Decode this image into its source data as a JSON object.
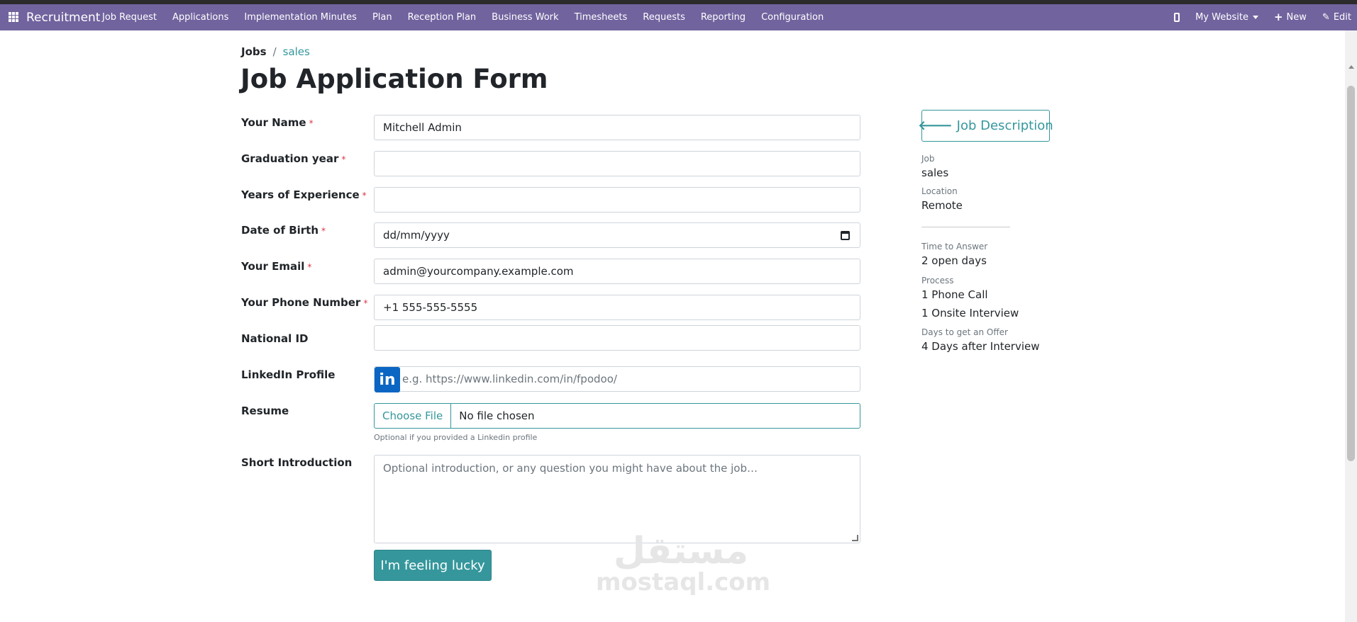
{
  "navbar": {
    "brand": "Recruitment",
    "items": [
      "Job Request",
      "Applications",
      "Implementation Minutes",
      "Plan",
      "Reception Plan",
      "Business Work",
      "Timesheets",
      "Requests",
      "Reporting",
      "Configuration"
    ],
    "website": "My Website",
    "new_label": "New",
    "edit_label": "Edit",
    "color": "#71639e"
  },
  "breadcrumb": {
    "root": "Jobs",
    "separator": "/",
    "current": "sales"
  },
  "page_title": "Job Application Form",
  "form": {
    "required_mark": "*",
    "name": {
      "label": "Your Name",
      "value": "Mitchell Admin"
    },
    "graduation": {
      "label": "Graduation year",
      "value": ""
    },
    "experience": {
      "label": "Years of Experience",
      "value": ""
    },
    "dob": {
      "label": "Date of Birth",
      "placeholder": "dd/mm/yyyy"
    },
    "email": {
      "label": "Your Email",
      "value": "admin@yourcompany.example.com"
    },
    "phone": {
      "label": "Your Phone Number",
      "value": "+1 555-555-5555"
    },
    "national_id": {
      "label": "National ID",
      "value": ""
    },
    "linkedin": {
      "label": "LinkedIn Profile",
      "logo_text": "in",
      "placeholder": "e.g. https://www.linkedin.com/in/fpodoo/"
    },
    "resume": {
      "label": "Resume",
      "choose_label": "Choose File",
      "file_status": "No file chosen",
      "help": "Optional if you provided a Linkedin profile"
    },
    "intro": {
      "label": "Short Introduction",
      "placeholder": "Optional introduction, or any question you might have about the job…"
    },
    "submit_label": "I'm feeling lucky",
    "accent_color": "#35979c"
  },
  "sidebar": {
    "job_description_label": "Job Description",
    "job_label": "Job",
    "job_value": "sales",
    "location_label": "Location",
    "location_value": "Remote",
    "time_label": "Time to Answer",
    "time_value": "2 open days",
    "process_label": "Process",
    "process_steps": [
      "1 Phone Call",
      "1 Onsite Interview"
    ],
    "offer_label": "Days to get an Offer",
    "offer_value": "4 Days after Interview"
  },
  "watermark": {
    "arabic": "مستقل",
    "latin": "mostaql.com"
  }
}
